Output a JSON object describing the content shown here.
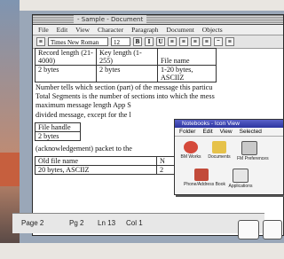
{
  "window": {
    "title": "- Sample - Document",
    "menus": [
      "File",
      "Edit",
      "View",
      "Character",
      "Paragraph",
      "Document",
      "Objects"
    ]
  },
  "toolbar": {
    "font": "Times New Roman",
    "size": "12",
    "buttons": [
      "B",
      "I",
      "U",
      "≡",
      "≡",
      "≡",
      "≡",
      "⁻",
      "≡"
    ]
  },
  "document": {
    "table1": [
      [
        "Record length (21-4000)",
        "Key length (1-255)",
        "File name"
      ],
      [
        "2 bytes",
        "2 bytes",
        "1-20 bytes, ASCIIZ"
      ]
    ],
    "paragraph": [
      "Number tells which section (part) of the message this particu",
      "Total Segments is the number of sections into which the mess",
      "maximum message length App S",
      "divided message, except for the l"
    ],
    "table2": [
      [
        "File handle"
      ],
      [
        "2 bytes"
      ]
    ],
    "ack_text": "(acknowledgement) packet to the",
    "table3": [
      [
        "Old file name",
        "N"
      ],
      [
        "20 bytes, ASCIIZ",
        "2"
      ]
    ]
  },
  "status": {
    "page": "Page 2",
    "pg": "Pg 2",
    "line": "Ln 13",
    "col": "Col 1"
  },
  "popup": {
    "title": "Notebooks - Icon View",
    "menus": [
      "Folder",
      "Edit",
      "View",
      "Selected"
    ],
    "items": [
      {
        "label": "BM Works",
        "color": "#d54a3b"
      },
      {
        "label": "Documents",
        "color": "#e6c24a"
      },
      {
        "label": "FM Preferences",
        "color": "#c9c9c9"
      },
      {
        "label": "Phone/Address Book",
        "color": "#c24b3a"
      },
      {
        "label": "Applications",
        "color": "#e6e6e6"
      }
    ]
  }
}
